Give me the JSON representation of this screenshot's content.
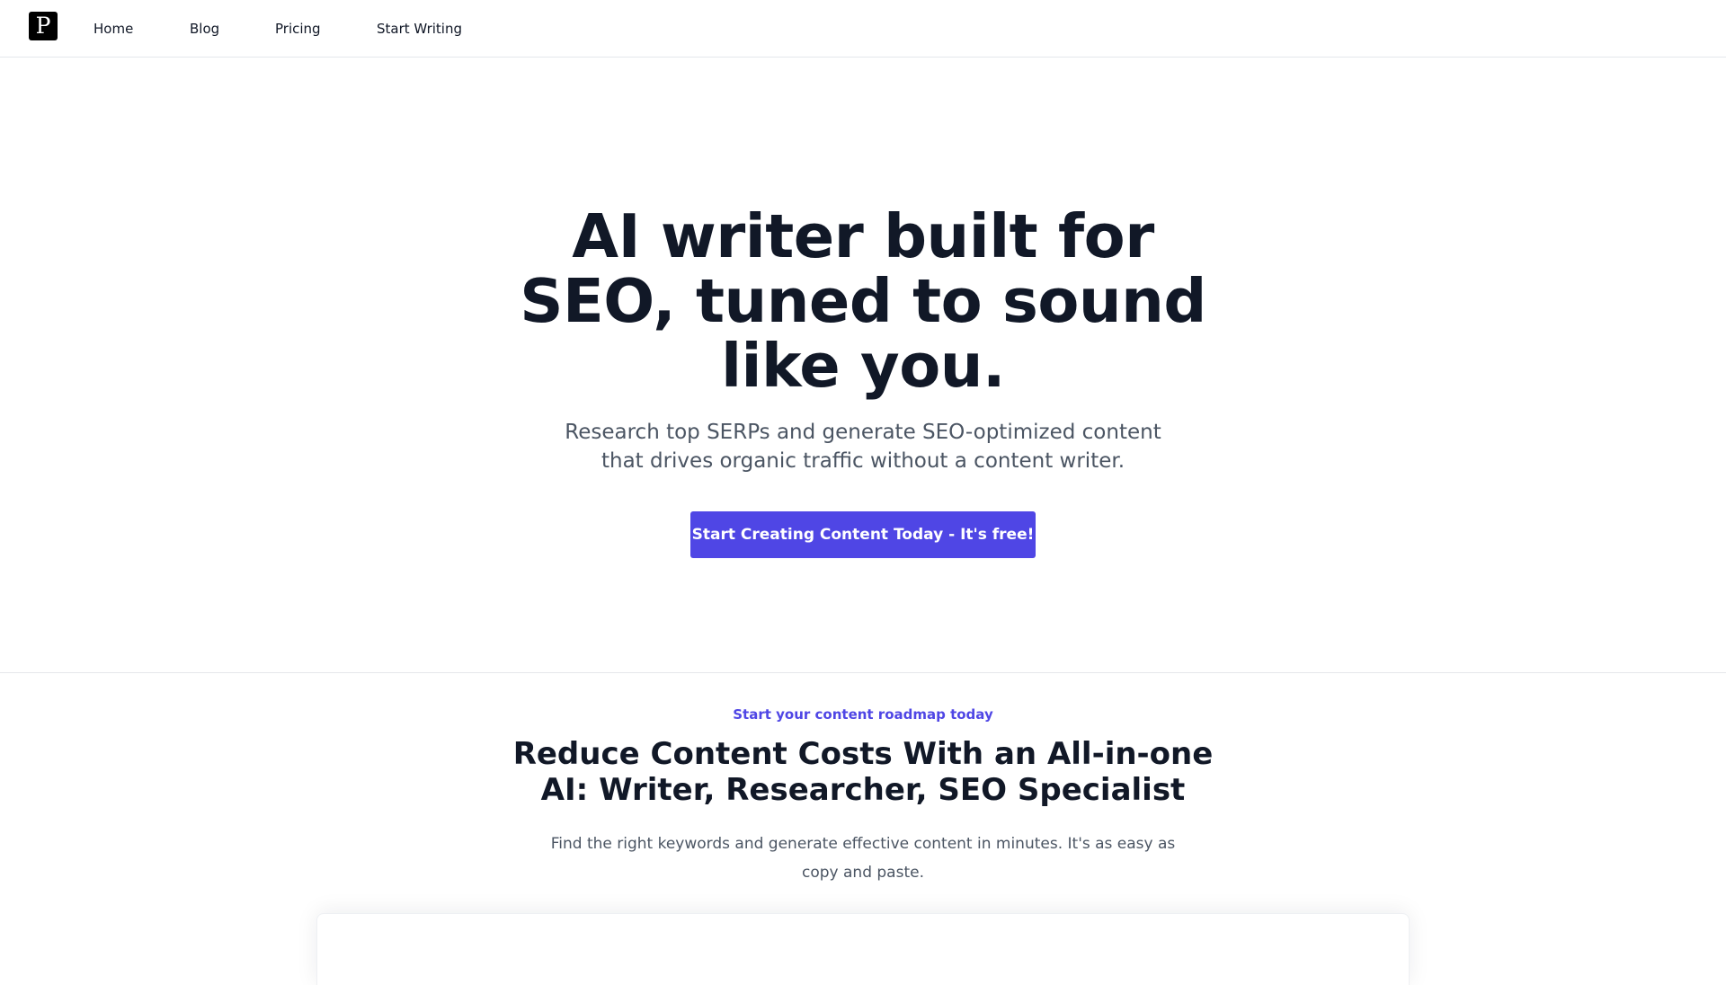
{
  "header": {
    "logo_letter": "P",
    "nav": {
      "home": "Home",
      "blog": "Blog",
      "pricing": "Pricing",
      "start_writing": "Start Writing"
    }
  },
  "hero": {
    "title": "AI writer built for SEO, tuned to sound like you.",
    "subtitle": "Research top SERPs and generate SEO-optimized content that drives organic traffic without a content writer.",
    "cta_label": "Start Creating Content Today - It's free!"
  },
  "features": {
    "eyebrow": "Start your content roadmap today",
    "title": "Reduce Content Costs With an All-in-one AI: Writer, Researcher, SEO Specialist",
    "subtitle": "Find the right keywords and generate effective content in minutes. It's as easy as copy and paste."
  },
  "colors": {
    "accent": "#4f46e5",
    "heading": "#111827",
    "body_text": "#4b5563",
    "divider": "#e5e7eb"
  }
}
